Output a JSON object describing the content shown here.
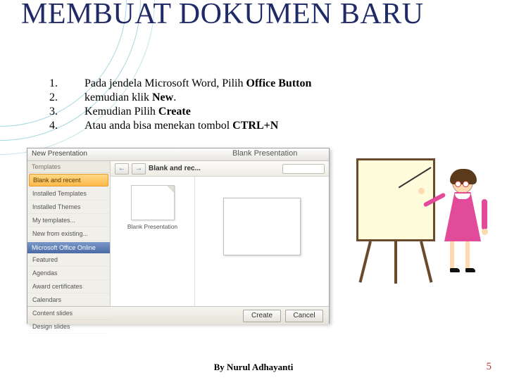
{
  "title": "MEMBUAT DOKUMEN BARU",
  "steps": [
    {
      "num": "1.",
      "pre": "Pada jendela Microsoft Word,  Pilih ",
      "bold": "Office Button",
      "post": ""
    },
    {
      "num": "2.",
      "pre": "kemudian klik ",
      "bold": "New",
      "post": "."
    },
    {
      "num": "3.",
      "pre": "Kemudian   Pilih ",
      "bold": "Create",
      "post": ""
    },
    {
      "num": "4.",
      "pre": "Atau anda bisa menekan tombol ",
      "bold": "CTRL+N",
      "post": ""
    }
  ],
  "dialog": {
    "title": "New Presentation",
    "sidebar_header": "Templates",
    "sidebar_items": [
      "Blank and recent",
      "Installed Templates",
      "Installed Themes",
      "My templates...",
      "New from existing..."
    ],
    "office_online_header": "Microsoft Office Online",
    "office_online_items": [
      "Featured",
      "Agendas",
      "Award certificates",
      "Calendars",
      "Content slides",
      "Design slides"
    ],
    "crumb": "Blank and rec...",
    "thumb_label": "Blank Presentation",
    "preview_heading": "Blank Presentation",
    "buttons": {
      "create": "Create",
      "cancel": "Cancel"
    }
  },
  "footer": "By Nurul Adhayanti",
  "page_number": "5"
}
